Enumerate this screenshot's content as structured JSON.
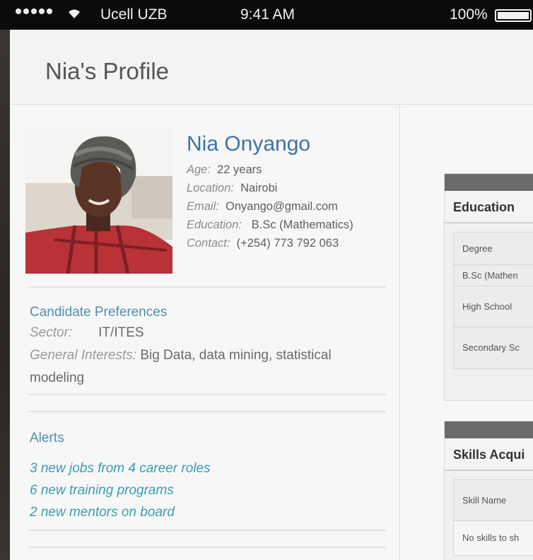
{
  "status_bar": {
    "carrier": "Ucell UZB",
    "time": "9:41 AM",
    "battery_pct": "100%"
  },
  "header": {
    "title": "Nia's Profile"
  },
  "profile": {
    "name": "Nia Onyango",
    "fields": [
      {
        "label": "Age:",
        "value": "22 years"
      },
      {
        "label": "Location:",
        "value": "Nairobi"
      },
      {
        "label": "Email:",
        "value": "Onyango@gmail.com"
      },
      {
        "label": "Education:",
        "value": "B.Sc (Mathematics)"
      },
      {
        "label": "Contact:",
        "value": "(+254) 773 792 063"
      }
    ]
  },
  "preferences": {
    "title": "Candidate Preferences",
    "sector_label": "Sector:",
    "sector_value": "IT/ITES",
    "interests_label": "General Interests:",
    "interests_value": "Big Data, data mining, statistical modeling"
  },
  "alerts": {
    "title": "Alerts",
    "items": [
      "3 new jobs from 4 career roles",
      "6 new training programs",
      "2 new mentors on board"
    ]
  },
  "education_panel": {
    "title": "Education",
    "header_cell": "Degree",
    "rows": [
      "B.Sc (Mathen",
      "High School",
      "Secondary Sc"
    ]
  },
  "skills_panel": {
    "title": "Skills Acqui",
    "header_cell": "Skill Name",
    "empty_text": "No skills to sh"
  },
  "colors": {
    "link_blue": "#3d72a8",
    "alert_teal": "#3c9bb0"
  }
}
